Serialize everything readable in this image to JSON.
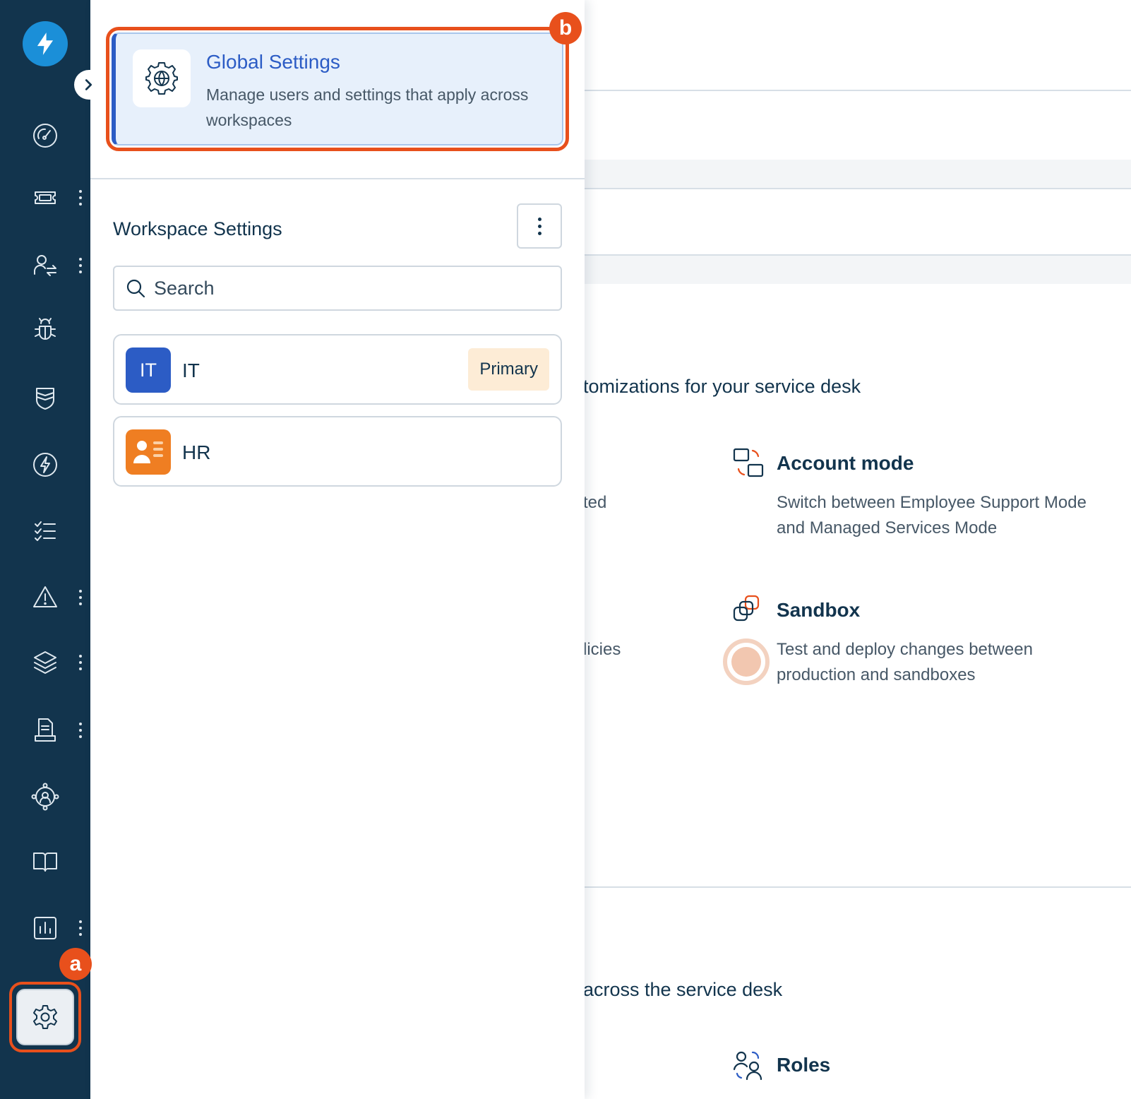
{
  "nav": {
    "items": [
      {
        "name": "dashboard-icon"
      },
      {
        "name": "tickets-icon"
      },
      {
        "name": "user-switch-icon"
      },
      {
        "name": "bug-icon"
      },
      {
        "name": "shield-icon"
      },
      {
        "name": "lightning-icon"
      },
      {
        "name": "checklist-icon"
      },
      {
        "name": "alert-icon"
      },
      {
        "name": "layers-icon"
      },
      {
        "name": "document-icon"
      },
      {
        "name": "org-chart-icon"
      },
      {
        "name": "book-icon"
      },
      {
        "name": "reports-icon"
      },
      {
        "name": "settings-icon"
      }
    ],
    "badge_a": "a"
  },
  "panel": {
    "global": {
      "title": "Global Settings",
      "desc": "Manage users and settings that apply across workspaces",
      "badge": "b"
    },
    "workspace_title": "Workspace Settings",
    "search_placeholder": "Search",
    "workspaces": [
      {
        "initials": "IT",
        "name": "IT",
        "tag": "Primary"
      },
      {
        "initials": "",
        "name": "HR",
        "tag": ""
      }
    ]
  },
  "background": {
    "intro_fragment": "tomizations for your service desk",
    "frag_1": "ted",
    "frag_2": "licies",
    "frag_3": "across the service desk",
    "account_mode": {
      "title": "Account mode",
      "desc": "Switch between Employee Support Mode and Managed Services Mode"
    },
    "sandbox": {
      "title": "Sandbox",
      "desc": "Test and deploy changes between production and sandboxes"
    },
    "roles": {
      "title": "Roles"
    }
  },
  "colors": {
    "nav_bg": "#12344d",
    "accent_blue": "#2c5cc5",
    "highlight_orange": "#e8501c",
    "hr_orange": "#ef7e22"
  }
}
